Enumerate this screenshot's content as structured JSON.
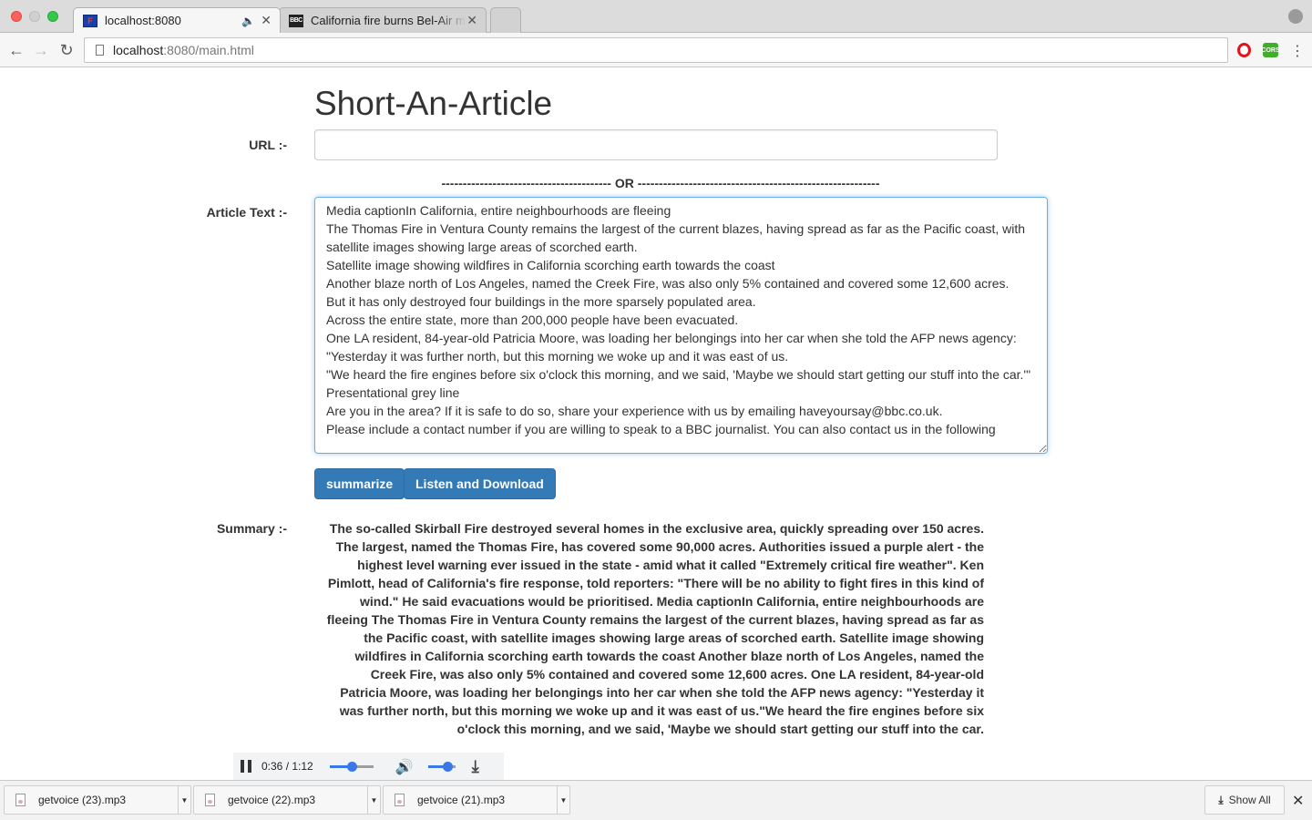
{
  "browser": {
    "tabs": [
      {
        "title": "localhost:8080",
        "favicon": "f-icon"
      },
      {
        "title": "California fire burns Bel-Air mansions",
        "favicon": "bbc-icon"
      }
    ],
    "address": {
      "host": "localhost",
      "path": ":8080/main.html"
    },
    "extensions": {
      "cors_label": "CORS"
    }
  },
  "app": {
    "title": "Short-An-Article",
    "url_label": "URL :-",
    "url_value": "",
    "or_divider": "---------------------------------------- OR ---------------------------------------------------------",
    "article_label": "Article Text :-",
    "article_text": "Media captionIn California, entire neighbourhoods are fleeing\nThe Thomas Fire in Ventura County remains the largest of the current blazes, having spread as far as the Pacific coast, with satellite images showing large areas of scorched earth.\nSatellite image showing wildfires in California scorching earth towards the coast\nAnother blaze north of Los Angeles, named the Creek Fire, was also only 5% contained and covered some 12,600 acres.\nBut it has only destroyed four buildings in the more sparsely populated area.\nAcross the entire state, more than 200,000 people have been evacuated.\nOne LA resident, 84-year-old Patricia Moore, was loading her belongings into her car when she told the AFP news agency:\n\"Yesterday it was further north, but this morning we woke up and it was east of us.\n\"We heard the fire engines before six o'clock this morning, and we said, 'Maybe we should start getting our stuff into the car.'\"\nPresentational grey line\nAre you in the area? If it is safe to do so, share your experience with us by emailing haveyoursay@bbc.co.uk.\nPlease include a contact number if you are willing to speak to a BBC journalist. You can also contact us in the following",
    "summarize_button": "summarize",
    "listen_button": "Listen and Download",
    "summary_label": "Summary :-",
    "summary_text": "The so-called Skirball Fire destroyed several homes in the exclusive area, quickly spreading over 150 acres. The largest, named the Thomas Fire, has covered some 90,000 acres. Authorities issued a purple alert - the highest level warning ever issued in the state - amid what it called \"Extremely critical fire weather\". Ken Pimlott, head of California's fire response, told reporters: \"There will be no ability to fight fires in this kind of wind.\" He said evacuations would be prioritised. Media captionIn California, entire neighbourhoods are fleeing The Thomas Fire in Ventura County remains the largest of the current blazes, having spread as far as the Pacific coast, with satellite images showing large areas of scorched earth. Satellite image showing wildfires in California scorching earth towards the coast Another blaze north of Los Angeles, named the Creek Fire, was also only 5% contained and covered some 12,600 acres. One LA resident, 84-year-old Patricia Moore, was loading her belongings into her car when she told the AFP news agency: \"Yesterday it was further north, but this morning we woke up and it was east of us.\"We heard the fire engines before six o'clock this morning, and we said, 'Maybe we should start getting our stuff into the car."
  },
  "player": {
    "time": "0:36 / 1:12",
    "progress_fraction": 0.5,
    "volume_fraction": 0.7
  },
  "downloads": {
    "items": [
      "getvoice (23).mp3",
      "getvoice (22).mp3",
      "getvoice (21).mp3"
    ],
    "show_all": "Show All"
  },
  "colors": {
    "primary_button": "#337ab7",
    "focus_border": "#66afe9",
    "player_accent": "#3b78e7"
  }
}
